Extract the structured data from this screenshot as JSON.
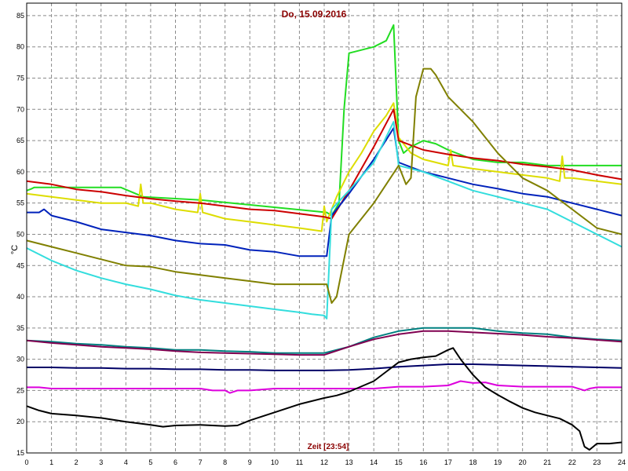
{
  "chart_data": {
    "type": "line",
    "title": "Do, 15.09.2016",
    "xlabel": "Zeit [23:54]",
    "ylabel": "°C",
    "xlim": [
      0,
      24
    ],
    "ylim": [
      15,
      87
    ],
    "x_ticks": [
      "0",
      "1",
      "2",
      "3",
      "4",
      "5",
      "6",
      "7",
      "8",
      "9",
      "10",
      "11",
      "12",
      "13",
      "14",
      "15",
      "16",
      "17",
      "18",
      "19",
      "20",
      "21",
      "22",
      "23",
      "24"
    ],
    "y_ticks": [
      "15",
      "20",
      "25",
      "30",
      "35",
      "40",
      "45",
      "50",
      "55",
      "60",
      "65",
      "70",
      "75",
      "80",
      "85"
    ],
    "grid": true,
    "series": [
      {
        "color": "#22dd22",
        "x": [
          0,
          0.2,
          0.3,
          3.8,
          4.7,
          7,
          12.1,
          12.3,
          12.6,
          12.8,
          13,
          13.5,
          14,
          14.5,
          14.8,
          15,
          15.2,
          15.5,
          16,
          16.5,
          17,
          18,
          19,
          20,
          21,
          22,
          23,
          24
        ],
        "y": [
          57,
          57.3,
          57.5,
          57.5,
          56,
          55.5,
          53.5,
          53,
          55,
          70,
          79,
          79.5,
          80,
          81,
          83.5,
          65,
          63,
          64,
          65,
          64.5,
          63.5,
          62,
          61.5,
          61.5,
          61,
          61,
          61,
          61
        ]
      },
      {
        "color": "#dddd00",
        "x": [
          0,
          1,
          2,
          3,
          4,
          4.5,
          4.6,
          4.7,
          5,
          6,
          6.9,
          7,
          7.1,
          8,
          9,
          10,
          11,
          11.9,
          12,
          12.1,
          12.5,
          13,
          13.5,
          14,
          14.5,
          14.8,
          15,
          15.5,
          16,
          16.5,
          17,
          17.1,
          17.2,
          18,
          19,
          20,
          21,
          21.5,
          21.6,
          21.7,
          22,
          23,
          24
        ],
        "y": [
          56.5,
          56,
          55.5,
          55,
          55,
          54.5,
          58,
          55,
          55,
          54,
          53.5,
          56.5,
          53.5,
          52.5,
          52,
          51.5,
          51,
          50.5,
          54.5,
          52,
          56,
          60,
          63,
          66.5,
          69,
          71,
          65.5,
          63,
          62,
          61.5,
          61,
          63.5,
          61,
          60.5,
          60,
          59.5,
          59,
          58.5,
          62.5,
          59,
          59,
          58.5,
          58
        ]
      },
      {
        "color": "#cc0000",
        "x": [
          0,
          1,
          2,
          3,
          4,
          5,
          6,
          7,
          8,
          9,
          10,
          11,
          12,
          12.3,
          13,
          14,
          14.8,
          15,
          16,
          17,
          18,
          19,
          20,
          21,
          22,
          23,
          24
        ],
        "y": [
          58.5,
          58,
          57.2,
          56.8,
          56.2,
          55.7,
          55.3,
          55,
          54.5,
          54,
          53.8,
          53.3,
          52.8,
          52.5,
          57,
          64,
          70,
          65,
          63.5,
          62.8,
          62.2,
          61.8,
          61.2,
          60.8,
          60.3,
          59.5,
          58.8
        ]
      },
      {
        "color": "#0022bb",
        "x": [
          0,
          0.5,
          0.7,
          1,
          2,
          3,
          4,
          5,
          6,
          7,
          8,
          9,
          10,
          11,
          12,
          12.1,
          12.3,
          13,
          14,
          14.8,
          15,
          16,
          17,
          18,
          19,
          20,
          21,
          22,
          23,
          24
        ],
        "y": [
          53.5,
          53.5,
          54,
          53,
          52,
          50.8,
          50.3,
          49.8,
          49,
          48.5,
          48.3,
          47.5,
          47.2,
          46.5,
          46.5,
          46.5,
          53,
          56.5,
          62,
          67,
          61.5,
          60,
          59,
          58,
          57.3,
          56.5,
          56,
          55,
          54,
          53
        ]
      },
      {
        "color": "#33dddd",
        "x": [
          0,
          1,
          2,
          3,
          4,
          5,
          6,
          7,
          8,
          9,
          10,
          11,
          11.5,
          12,
          12.1,
          12.3,
          13,
          14,
          14.8,
          15,
          16,
          17,
          18,
          19,
          20,
          21,
          22,
          23,
          24
        ],
        "y": [
          47.8,
          45.8,
          44.2,
          43,
          42,
          41.2,
          40.2,
          39.5,
          39,
          38.5,
          38,
          37.5,
          37.2,
          37,
          36.5,
          54,
          57,
          61.5,
          68,
          61,
          60,
          58.5,
          57,
          56,
          55,
          54,
          52,
          50,
          48
        ]
      },
      {
        "color": "#808000",
        "x": [
          0,
          0.5,
          1,
          2,
          3,
          4,
          5,
          6,
          7,
          8,
          9,
          10,
          11,
          12,
          12.1,
          12.3,
          12.5,
          13,
          14,
          14.5,
          15,
          15.3,
          15.5,
          15.7,
          16,
          16.3,
          16.5,
          17,
          18,
          19,
          20,
          21,
          22,
          23,
          24
        ],
        "y": [
          49,
          48.5,
          48,
          47,
          46,
          45,
          44.8,
          44,
          43.5,
          43,
          42.5,
          42,
          42,
          42,
          42,
          39,
          40,
          50,
          55,
          58,
          61,
          58,
          59,
          72,
          76.5,
          76.5,
          75.5,
          72,
          68,
          63,
          59,
          57,
          54,
          51,
          50
        ]
      },
      {
        "color": "#008080",
        "x": [
          0,
          1,
          2,
          3,
          4,
          5,
          6,
          7,
          8,
          9,
          10,
          11,
          12,
          13,
          14,
          15,
          16,
          17,
          18,
          19,
          20,
          21,
          22,
          23,
          24
        ],
        "y": [
          33,
          32.8,
          32.5,
          32.3,
          32,
          31.8,
          31.5,
          31.5,
          31.3,
          31.2,
          31,
          31,
          31,
          32,
          33.5,
          34.5,
          35,
          35,
          35,
          34.5,
          34.2,
          34,
          33.5,
          33.2,
          33
        ]
      },
      {
        "color": "#800050",
        "x": [
          0,
          1,
          2,
          3,
          4,
          5,
          6,
          7,
          8,
          9,
          10,
          11,
          12,
          13,
          14,
          15,
          16,
          17,
          18,
          19,
          20,
          21,
          22,
          23,
          24
        ],
        "y": [
          33,
          32.6,
          32.3,
          32,
          31.8,
          31.6,
          31.3,
          31.1,
          31,
          30.9,
          30.8,
          30.7,
          30.7,
          32,
          33.2,
          34,
          34.5,
          34.5,
          34.3,
          34.1,
          33.9,
          33.6,
          33.4,
          33.1,
          32.8
        ]
      },
      {
        "color": "#000066",
        "x": [
          0,
          1,
          2,
          3,
          4,
          5,
          6,
          7,
          8,
          9,
          10,
          11,
          12,
          13,
          14,
          15,
          16,
          17,
          18,
          19,
          20,
          21,
          22,
          23,
          24
        ],
        "y": [
          28.7,
          28.7,
          28.6,
          28.6,
          28.5,
          28.5,
          28.4,
          28.4,
          28.3,
          28.3,
          28.2,
          28.2,
          28.2,
          28.3,
          28.5,
          28.8,
          29,
          29.2,
          29.2,
          29.1,
          29,
          28.9,
          28.8,
          28.7,
          28.6
        ]
      },
      {
        "color": "#dd00dd",
        "x": [
          0,
          0.5,
          1,
          2,
          3,
          4,
          5,
          6,
          7,
          7.5,
          8,
          8.2,
          8.5,
          9,
          10,
          11,
          12,
          13,
          14,
          15,
          16,
          17,
          17.5,
          18,
          18.5,
          19,
          20,
          21,
          22,
          22.5,
          22.7,
          23,
          24
        ],
        "y": [
          25.5,
          25.5,
          25.3,
          25.3,
          25.3,
          25.3,
          25.3,
          25.3,
          25.3,
          25,
          25,
          24.6,
          25,
          25,
          25.3,
          25.3,
          25.3,
          25.3,
          25.3,
          25.6,
          25.6,
          25.8,
          26.5,
          26.2,
          26.3,
          25.8,
          25.6,
          25.6,
          25.6,
          25,
          25.3,
          25.5,
          25.5
        ]
      },
      {
        "color": "#000000",
        "x": [
          0,
          0.5,
          1,
          2,
          3,
          4,
          5,
          5.5,
          6,
          7,
          8,
          8.5,
          9,
          10,
          11,
          12,
          12.5,
          13,
          14,
          14.5,
          15,
          15.5,
          16,
          16.5,
          17,
          17.2,
          17.5,
          18,
          18.5,
          19,
          19.5,
          20,
          20.5,
          21,
          21.5,
          22,
          22.3,
          22.5,
          22.7,
          23,
          23.5,
          24
        ],
        "y": [
          22.5,
          21.8,
          21.3,
          21,
          20.6,
          20,
          19.5,
          19.2,
          19.4,
          19.5,
          19.3,
          19.4,
          20.2,
          21.5,
          22.8,
          23.8,
          24.2,
          24.8,
          26.5,
          28,
          29.5,
          30,
          30.3,
          30.5,
          31.5,
          31.8,
          30,
          27.5,
          25.5,
          24.3,
          23.2,
          22.2,
          21.5,
          21,
          20.5,
          19.5,
          18.5,
          16,
          15.5,
          16.5,
          16.5,
          16.7
        ]
      }
    ]
  }
}
